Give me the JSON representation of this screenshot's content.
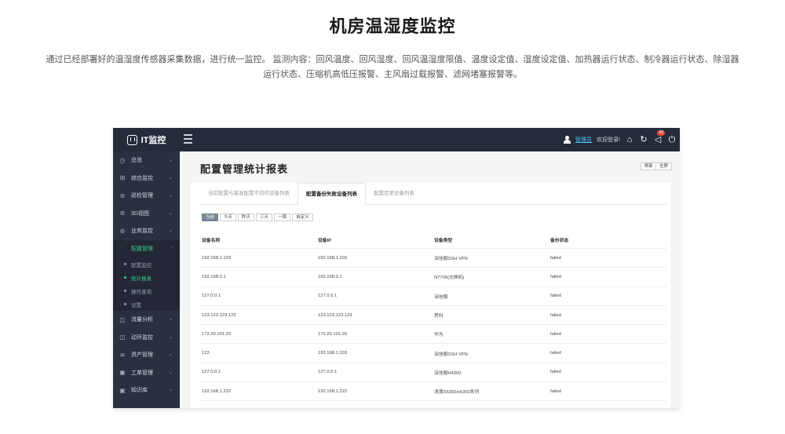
{
  "hero": {
    "title": "机房温湿度监控",
    "desc_line1": "通过已经部署好的温湿度传感器采集数据，进行统一监控。 监测内容：回风温度、回风湿度、回风温湿度限值、温度设定值、湿度设定值、加热器运行状态、制冷器运行状态、除湿器",
    "desc_line2": "运行状态、压缩机高低压报警、主风扇过载报警、滤网堵塞报警等。"
  },
  "app": {
    "brand": "IT监控",
    "user_name": "管理员",
    "welcome": "欢迎登录!",
    "badge": "42",
    "icons": [
      "home-icon",
      "refresh-icon",
      "send-icon",
      "power-icon"
    ]
  },
  "sidebar": {
    "items": [
      {
        "label": "总览",
        "icon": "clock-icon",
        "glyph": "◷"
      },
      {
        "label": "综合监控",
        "icon": "monitor-icon",
        "glyph": "⊞"
      },
      {
        "label": "巡检管理",
        "icon": "patrol-icon",
        "glyph": "⊛"
      },
      {
        "label": "3D视图",
        "icon": "cube-icon",
        "glyph": "⊛"
      },
      {
        "label": "业务监控",
        "icon": "business-icon",
        "glyph": "⊛"
      },
      {
        "label": "配置管理",
        "icon": "config-icon",
        "glyph": "⫶"
      }
    ],
    "sub_items": [
      {
        "label": "配置监控"
      },
      {
        "label": "统计报表"
      },
      {
        "label": "操作查询"
      },
      {
        "label": "设置"
      }
    ],
    "items_after": [
      {
        "label": "流量分析",
        "icon": "traffic-icon",
        "glyph": "◫"
      },
      {
        "label": "动环监控",
        "icon": "environment-icon",
        "glyph": "◫"
      },
      {
        "label": "资产管理",
        "icon": "asset-icon",
        "glyph": "≋"
      },
      {
        "label": "工单管理",
        "icon": "ticket-icon",
        "glyph": "▣"
      },
      {
        "label": "知识库",
        "icon": "knowledge-icon",
        "glyph": "▣"
      }
    ]
  },
  "main": {
    "title": "配置管理统计报表",
    "refresh_label": "刷新",
    "fullscreen_label": "全屏",
    "tabs": [
      {
        "label": "当前配置与基准配置不同的设备列表"
      },
      {
        "label": "配置备份失败设备列表"
      },
      {
        "label": "配置变更设备列表"
      }
    ],
    "filters": [
      "当前",
      "今天",
      "昨天",
      "三天",
      "一周",
      "自定义"
    ],
    "table": {
      "headers": [
        "设备名称",
        "设备IP",
        "设备类型",
        "备份状态"
      ],
      "rows": [
        [
          "192.168.1.103",
          "192.168.1.103",
          "深信服SSH VPN",
          "failed"
        ],
        [
          "192.168.0.1",
          "192.168.0.1",
          "N7706(交换机)",
          "failed"
        ],
        [
          "127.0.0.1",
          "127.0.0.1",
          "深信服",
          "failed"
        ],
        [
          "123.123.123.123",
          "123.123.123.123",
          "思科",
          "failed"
        ],
        [
          "172.20.101.20",
          "172.20.101.20",
          "华为",
          "failed"
        ],
        [
          "123",
          "192.168.1.103",
          "深信服SSH VPN",
          "failed"
        ],
        [
          "127.0.0.1",
          "127.0.0.1",
          "深信服H4300",
          "failed"
        ],
        [
          "192.168.1.222",
          "192.168.1.222",
          "浪潮S5350/s6350系列",
          "failed"
        ]
      ]
    }
  }
}
